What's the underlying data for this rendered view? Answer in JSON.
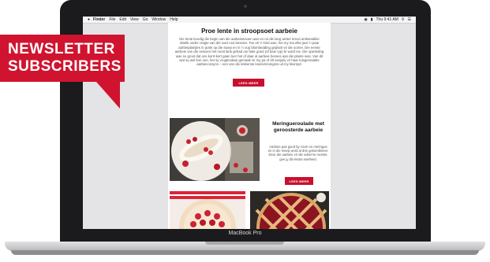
{
  "laptop": {
    "brand_label": "MacBook Pro"
  },
  "menubar": {
    "app": "Finder",
    "items": [
      "File",
      "Edit",
      "View",
      "Go",
      "Window",
      "Help"
    ],
    "clock": "Thu 9:41 AM"
  },
  "banner": {
    "line1": "NEWSLETTER",
    "line2": "SUBSCRIBERS"
  },
  "email": {
    "title": "Proe lente in stroopsoet aarbeie",
    "body": "Die lente kondig die begin van die aarbeiseisoen aan en nú die lang winter kreun amkanialike skielik onder vragte van dié soet rooi bessies. Toe ek 'n kind was, het my ma elke jaar 'n paar aarbeiplantjies in potte op die stoep en in 'n oop blombedding geplant vir die somer. Die eerste aarbeie van die seisoen het nooit lank gehad om fade goed (of baie ryp) te word nie. Die opwinding was so groot dat ons korrt-kort gaan loer het of daar al aarbeie besses aan die plante was. Van dit wat sy-wel kon oes, het sy vrugtesdaar gemaak vir my pa of dit vanjuily vir haar tuisgemaakte aarbeiconsyns – een van die lekkerste koekvrinningins uit my kleintyd.",
    "button1": "LEES MEER",
    "recipe2": {
      "title": "Meringueroulade met geroosterde aarbeie",
      "body": "Aarbeie pas goed by room en meringue en in die resep word al drie gekombineer. Deur die aarbeie vir die vulsel te rooster, gee jy dit ekstra soetheid.",
      "button": "LEES MEER"
    }
  }
}
